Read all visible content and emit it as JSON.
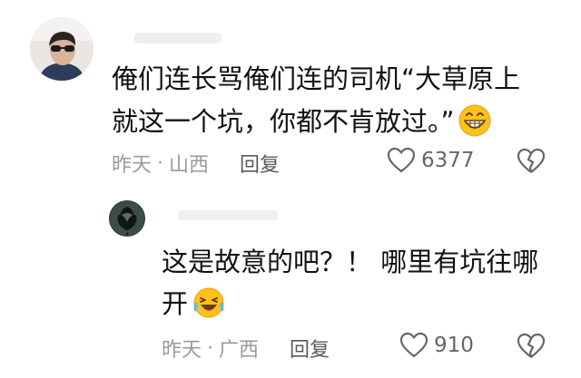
{
  "comments": [
    {
      "text_line1": "俺们连长骂俺们连的司机“大草原上",
      "text_line2": "就这一个坑，你都不肯放过。”",
      "emoji": "grinning-face",
      "time": "昨天",
      "separator": "·",
      "location": "山西",
      "reply_label": "回复",
      "like_count": "6377"
    },
    {
      "text_line1": "这是故意的吧？！ 哪里有坑往哪",
      "text_line2": "开",
      "emoji": "laughing-crying-face",
      "time": "昨天",
      "separator": "·",
      "location": "广西",
      "reply_label": "回复",
      "like_count": "910"
    }
  ],
  "colors": {
    "text": "#111111",
    "meta": "#9a9a9a",
    "reply": "#5a5a5a",
    "icon": "#666666"
  }
}
